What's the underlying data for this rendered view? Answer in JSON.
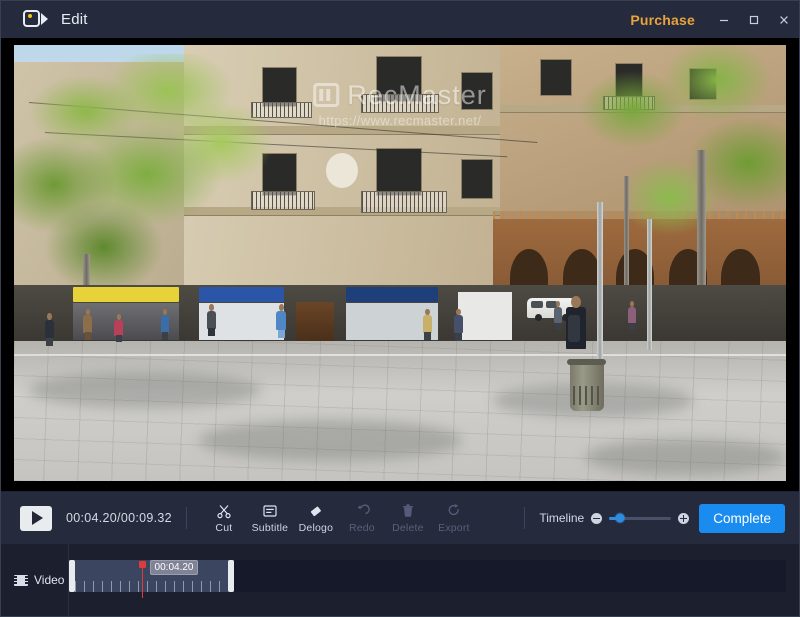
{
  "window": {
    "title": "Edit",
    "app_icon": "video-camera-icon",
    "purchase_label": "Purchase",
    "controls": {
      "minimize": "minimize-icon",
      "maximize": "maximize-icon",
      "close": "close-icon"
    }
  },
  "preview": {
    "watermark_text": "RecMaster",
    "watermark_url": "https://www.recmaster.net/",
    "watermark_logo": "recmaster-logo-icon",
    "scene_description": "Sunlit pedestrian plaza with stone buildings, shops, trees and passers-by"
  },
  "toolbar": {
    "play_icon": "play-icon",
    "timecode": "00:04.20/00:09.32",
    "tools": [
      {
        "label": "Cut",
        "icon": "scissors-icon",
        "disabled": false
      },
      {
        "label": "Subtitle",
        "icon": "subtitle-icon",
        "disabled": false
      },
      {
        "label": "Delogo",
        "icon": "eraser-icon",
        "disabled": false
      },
      {
        "label": "Redo",
        "icon": "redo-arrow-icon",
        "disabled": true
      },
      {
        "label": "Delete",
        "icon": "trash-icon",
        "disabled": true
      },
      {
        "label": "Export",
        "icon": "export-icon",
        "disabled": true
      }
    ],
    "timeline_label": "Timeline",
    "zoom_out_icon": "zoom-out-icon",
    "zoom_in_icon": "zoom-in-icon",
    "zoom_percent": 18,
    "complete_label": "Complete"
  },
  "timeline": {
    "track_label": "Video",
    "track_icon": "film-strip-icon",
    "playhead_time": "00:04.20",
    "playhead_percent": 44,
    "clip_start_percent": 0,
    "clip_width_percent": 23
  },
  "colors": {
    "accent_blue": "#1a8cf0",
    "purchase_orange": "#e8a33d",
    "playhead_red": "#e03b3b",
    "chrome_dark": "#252a3c",
    "timeline_bg": "#1b1f2e"
  }
}
